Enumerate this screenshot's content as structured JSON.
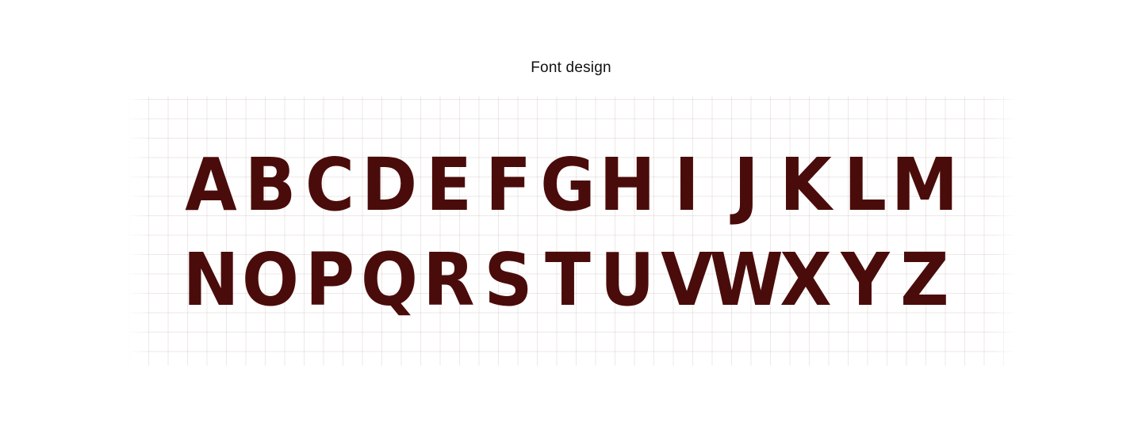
{
  "header": {
    "title": "Font design"
  },
  "colors": {
    "glyph": "#4a0c0a",
    "background": "#ffffff",
    "grid": "#e8dede"
  },
  "specimen": {
    "rows": [
      [
        "A",
        "B",
        "C",
        "D",
        "E",
        "F",
        "G",
        "H",
        "I",
        "J",
        "K",
        "L",
        "M"
      ],
      [
        "N",
        "O",
        "P",
        "Q",
        "R",
        "S",
        "T",
        "U",
        "V",
        "W",
        "X",
        "Y",
        "Z"
      ]
    ]
  }
}
